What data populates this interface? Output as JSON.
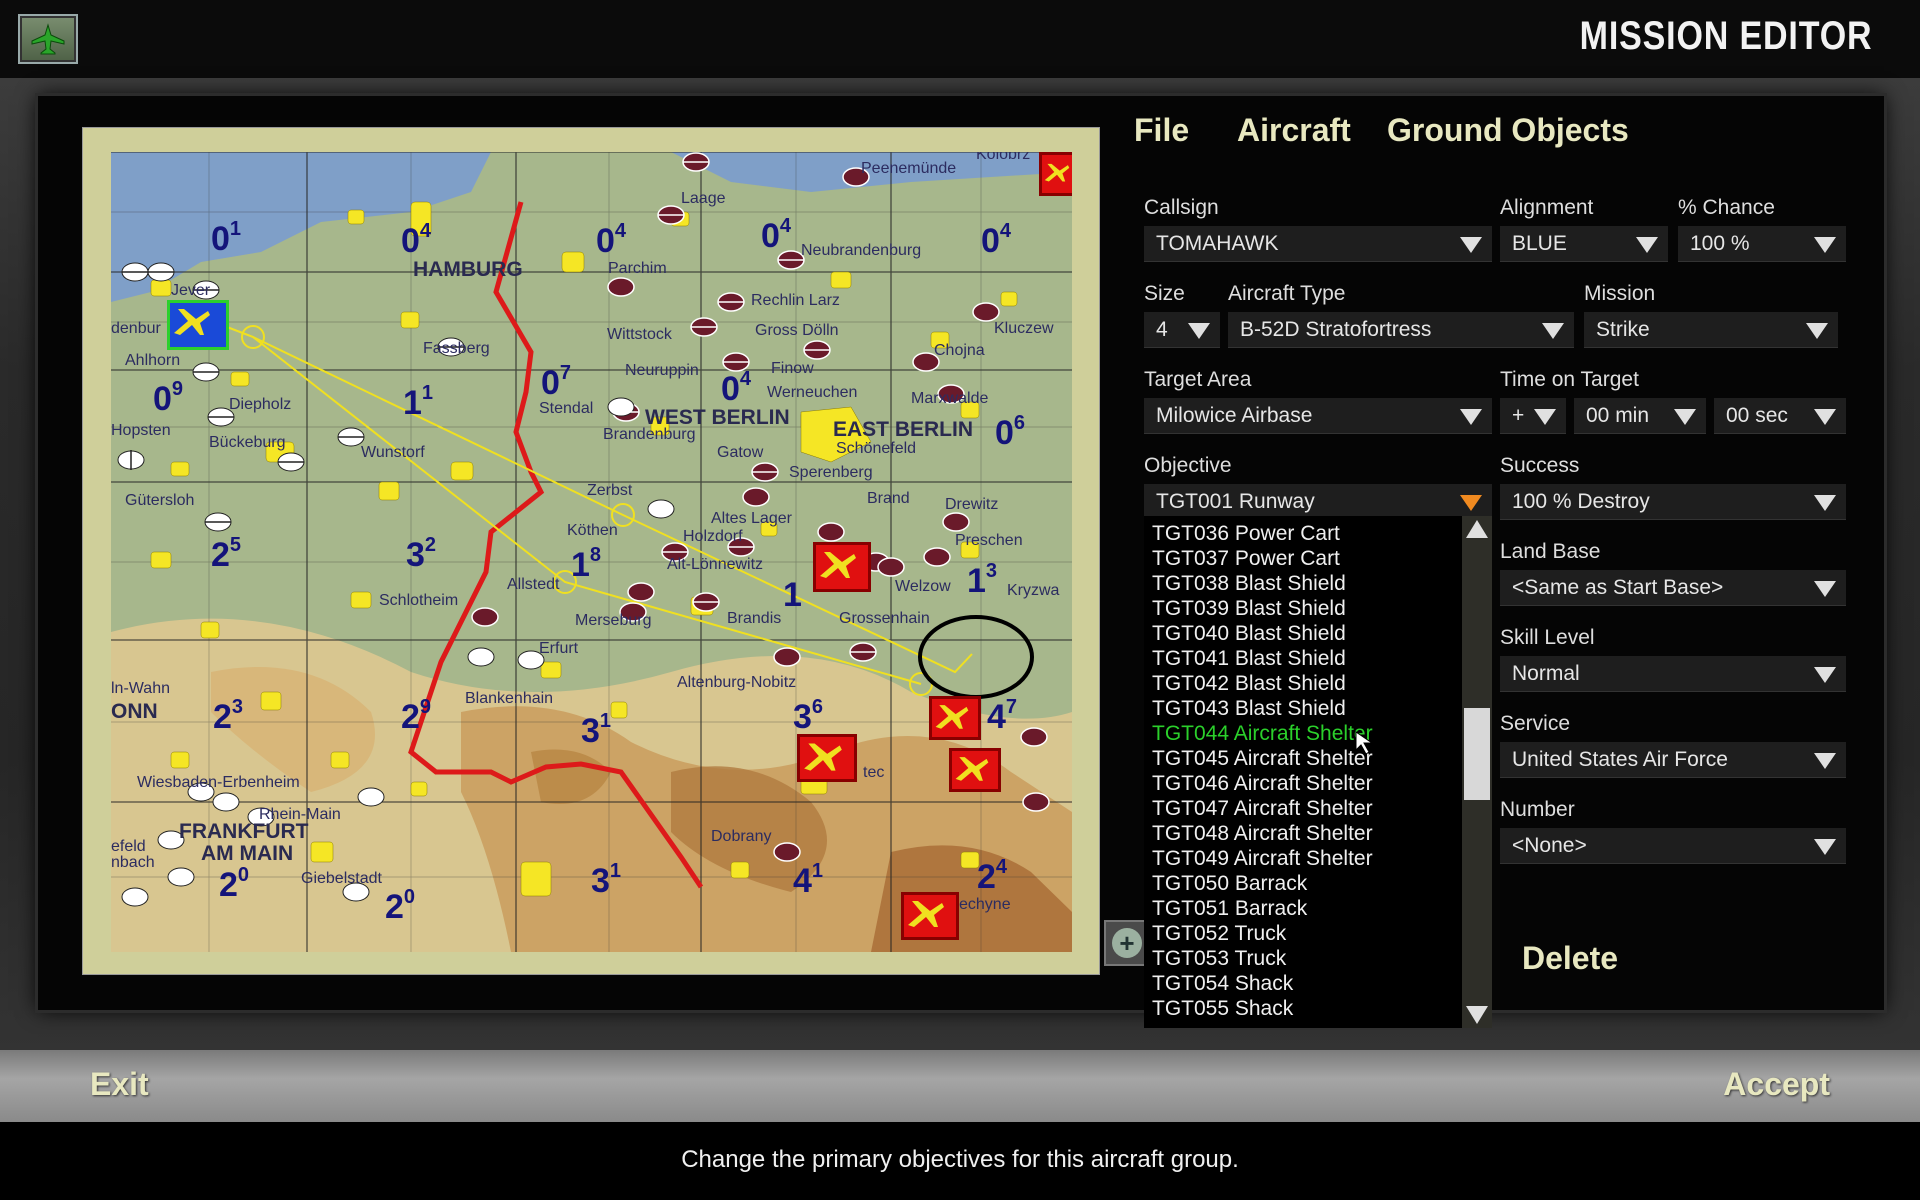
{
  "app": {
    "title": "MISSION EDITOR"
  },
  "menu": {
    "file": "File",
    "aircraft": "Aircraft",
    "ground_objects": "Ground Objects"
  },
  "form": {
    "callsign": {
      "label": "Callsign",
      "value": "TOMAHAWK"
    },
    "alignment": {
      "label": "Alignment",
      "value": "BLUE"
    },
    "chance": {
      "label": "% Chance",
      "value": "100 %"
    },
    "size": {
      "label": "Size",
      "value": "4"
    },
    "aircraft_type": {
      "label": "Aircraft Type",
      "value": "B-52D Stratofortress"
    },
    "mission": {
      "label": "Mission",
      "value": "Strike"
    },
    "target_area": {
      "label": "Target Area",
      "value": "Milowice Airbase"
    },
    "time_on_target": {
      "label": "Time on Target",
      "sign": "+",
      "min": "00 min",
      "sec": "00 sec"
    },
    "objective": {
      "label": "Objective",
      "value": "TGT001 Runway"
    },
    "success": {
      "label": "Success",
      "value": "100 % Destroy"
    },
    "land_base": {
      "label": "Land Base",
      "value": "<Same as Start Base>"
    },
    "skill_level": {
      "label": "Skill Level",
      "value": "Normal"
    },
    "service": {
      "label": "Service",
      "value": "United States Air Force"
    },
    "number": {
      "label": "Number",
      "value": "<None>"
    }
  },
  "objective_options": [
    "TGT036 Power Cart",
    "TGT037 Power Cart",
    "TGT038 Blast Shield",
    "TGT039 Blast Shield",
    "TGT040 Blast Shield",
    "TGT041 Blast Shield",
    "TGT042 Blast Shield",
    "TGT043 Blast Shield",
    "TGT044 Aircraft Shelter",
    "TGT045 Aircraft Shelter",
    "TGT046 Aircraft Shelter",
    "TGT047 Aircraft Shelter",
    "TGT048 Aircraft Shelter",
    "TGT049 Aircraft Shelter",
    "TGT050 Barrack",
    "TGT051 Barrack",
    "TGT052 Truck",
    "TGT053 Truck",
    "TGT054 Shack",
    "TGT055 Shack"
  ],
  "objective_selected_index": 8,
  "buttons": {
    "delete": "Delete",
    "exit": "Exit",
    "accept": "Accept"
  },
  "status": "Change the primary objectives for this aircraft group.",
  "map": {
    "grid_numbers": [
      {
        "n": "0",
        "s": "1"
      },
      {
        "n": "0",
        "s": "4"
      },
      {
        "n": "0",
        "s": "4"
      },
      {
        "n": "0",
        "s": "4"
      },
      {
        "n": "0",
        "s": "4"
      },
      {
        "n": "0",
        "s": "9"
      },
      {
        "n": "1",
        "s": "1"
      },
      {
        "n": "0",
        "s": "7"
      },
      {
        "n": "0",
        "s": "4"
      },
      {
        "n": "0",
        "s": "6"
      },
      {
        "n": "2",
        "s": "5"
      },
      {
        "n": "3",
        "s": "2"
      },
      {
        "n": "1",
        "s": "8"
      },
      {
        "n": "1",
        "s": ""
      },
      {
        "n": "1",
        "s": "3"
      },
      {
        "n": "2",
        "s": "3"
      },
      {
        "n": "2",
        "s": "9"
      },
      {
        "n": "3",
        "s": "1"
      },
      {
        "n": "3",
        "s": "6"
      },
      {
        "n": "4",
        "s": "7"
      },
      {
        "n": "2",
        "s": "0"
      },
      {
        "n": "2",
        "s": "0"
      },
      {
        "n": "3",
        "s": "1"
      },
      {
        "n": "4",
        "s": "1"
      },
      {
        "n": "2",
        "s": "4"
      }
    ],
    "cities": [
      "Peenemünde",
      "Kolobrz",
      "Laage",
      "HAMBURG",
      "Neubrandenburg",
      "Parchim",
      "Jever",
      "Rechlin Larz",
      "Wittstock",
      "Gross Dölln",
      "Kluczew",
      "denbur",
      "Ahlhorn",
      "Fassberg",
      "Chojna",
      "Neuruppin",
      "Finow",
      "Werneuchen",
      "Marxwalde",
      "Diepholz",
      "Stendal",
      "WEST BERLIN",
      "EAST BERLIN",
      "Hopsten",
      "Brandenburg",
      "Schönefeld",
      "Bückeburg",
      "Wunstorf",
      "Gatow",
      "Sperenberg",
      "Gütersloh",
      "Zerbst",
      "Brand",
      "Drewitz",
      "Altes Lager",
      "Köthen",
      "Holzdorf",
      "Preschen",
      "Alt-Lönnewitz",
      "Welzow",
      "Kryzwa",
      "Schlotheim",
      "Allstedt",
      "Merseburg",
      "Brandis",
      "Grossenhain",
      "Erfurt",
      "Altenburg-Nobitz",
      "Blankenhain",
      "ln-Wahn",
      "ONN",
      "Wiesbaden-Erbenheim",
      "Rhein-Main",
      "FRANKFURT",
      "AM MAIN",
      "efeld",
      "nbach",
      "Giebelstadt",
      "Dobrany",
      "echyne",
      "tec"
    ]
  }
}
